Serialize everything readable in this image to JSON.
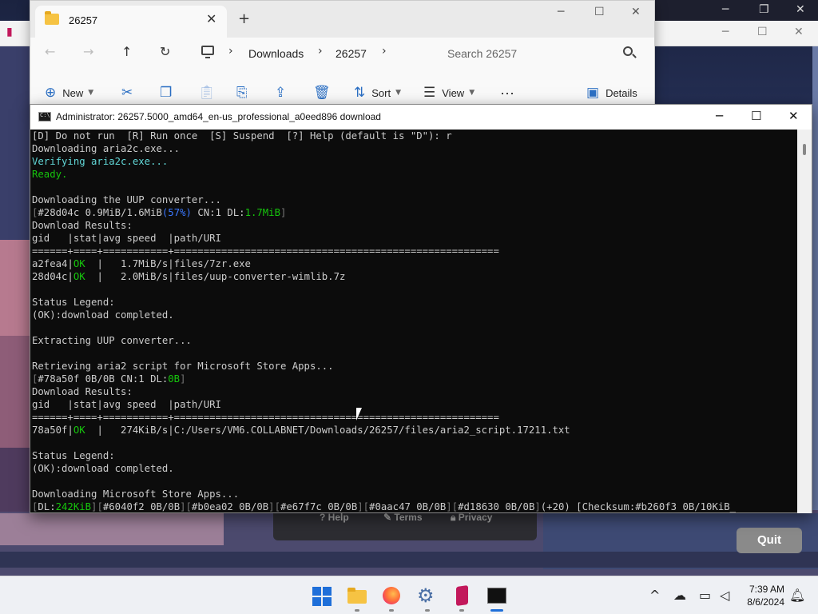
{
  "explorer": {
    "tab_title": "26257",
    "new_tab_symbol": "+",
    "breadcrumb": [
      "Downloads",
      "26257"
    ],
    "search_placeholder": "Search 26257",
    "commands": {
      "new": "New",
      "sort": "Sort",
      "view": "View",
      "more": "···",
      "details": "Details"
    }
  },
  "console": {
    "title": "Administrator:  26257.5000_amd64_en-us_professional_a0eed896 download",
    "lines": [
      [
        {
          "t": "[D] Do not run  [R] Run once  [S] Suspend  [?] Help (default is \"D\"): r"
        }
      ],
      [
        {
          "t": "Downloading aria2c.exe..."
        }
      ],
      [
        {
          "t": "Verifying aria2c.exe...",
          "c": "c"
        }
      ],
      [
        {
          "t": "Ready.",
          "c": "g"
        }
      ],
      [
        {
          "t": ""
        }
      ],
      [
        {
          "t": "Downloading the UUP converter..."
        }
      ],
      [
        {
          "t": "[",
          "c": "gr"
        },
        {
          "t": "#28d04c 0.9MiB/1.6MiB"
        },
        {
          "t": "(57%)",
          "c": "b"
        },
        {
          "t": " CN:1 DL:"
        },
        {
          "t": "1.7MiB",
          "c": "g"
        },
        {
          "t": "]",
          "c": "gr"
        }
      ],
      [
        {
          "t": "Download Results:"
        }
      ],
      [
        {
          "t": "gid   |stat|avg speed  |path/URI"
        }
      ],
      [
        {
          "t": "======+====+===========+======================================================="
        }
      ],
      [
        {
          "t": "a2fea4|"
        },
        {
          "t": "OK",
          "c": "g"
        },
        {
          "t": "  |   1.7MiB/s|files/7zr.exe"
        }
      ],
      [
        {
          "t": "28d04c|"
        },
        {
          "t": "OK",
          "c": "g"
        },
        {
          "t": "  |   2.0MiB/s|files/uup-converter-wimlib.7z"
        }
      ],
      [
        {
          "t": ""
        }
      ],
      [
        {
          "t": "Status Legend:"
        }
      ],
      [
        {
          "t": "(OK):download completed."
        }
      ],
      [
        {
          "t": ""
        }
      ],
      [
        {
          "t": "Extracting UUP converter..."
        }
      ],
      [
        {
          "t": ""
        }
      ],
      [
        {
          "t": "Retrieving aria2 script for Microsoft Store Apps..."
        }
      ],
      [
        {
          "t": "[",
          "c": "gr"
        },
        {
          "t": "#78a50f 0B/0B CN:1 DL:"
        },
        {
          "t": "0B",
          "c": "g"
        },
        {
          "t": "]",
          "c": "gr"
        }
      ],
      [
        {
          "t": "Download Results:"
        }
      ],
      [
        {
          "t": "gid   |stat|avg speed  |path/URI"
        }
      ],
      [
        {
          "t": "======+====+===========+======================================================="
        }
      ],
      [
        {
          "t": "78a50f|"
        },
        {
          "t": "OK",
          "c": "g"
        },
        {
          "t": "  |   274KiB/s|C:/Users/VM6.COLLABNET/Downloads/26257/files/aria2_script.17211.txt"
        }
      ],
      [
        {
          "t": ""
        }
      ],
      [
        {
          "t": "Status Legend:"
        }
      ],
      [
        {
          "t": "(OK):download completed."
        }
      ],
      [
        {
          "t": ""
        }
      ],
      [
        {
          "t": "Downloading Microsoft Store Apps..."
        }
      ],
      [
        {
          "t": "[",
          "c": "gr"
        },
        {
          "t": "DL:"
        },
        {
          "t": "242KiB",
          "c": "g"
        },
        {
          "t": "][",
          "c": "gr"
        },
        {
          "t": "#6040f2 0B/0B"
        },
        {
          "t": "][",
          "c": "gr"
        },
        {
          "t": "#b0ea02 0B/0B"
        },
        {
          "t": "][",
          "c": "gr"
        },
        {
          "t": "#e67f7c 0B/0B"
        },
        {
          "t": "][",
          "c": "gr"
        },
        {
          "t": "#0aac47 0B/0B"
        },
        {
          "t": "][",
          "c": "gr"
        },
        {
          "t": "#d18630 0B/0B"
        },
        {
          "t": "]",
          "c": "gr"
        },
        {
          "t": "(+20) [Checksum:#b260f3 0B/10KiB_"
        }
      ]
    ]
  },
  "web_footer": {
    "help": "Help",
    "terms": "Terms",
    "privacy": "Privacy",
    "quit": "Quit"
  },
  "taskbar": {
    "time": "7:39 AM",
    "date": "8/6/2024"
  },
  "colors": {
    "console_bg": "#0c0c0c",
    "console_text": "#cccccc",
    "console_green": "#16c60c",
    "console_cyan": "#61d6d6",
    "console_blue": "#3b78ff",
    "accent": "#1e6fd9"
  }
}
